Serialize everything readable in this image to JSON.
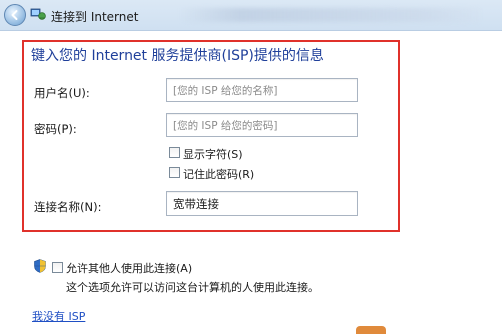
{
  "window": {
    "title": "连接到 Internet"
  },
  "form": {
    "heading": "键入您的 Internet 服务提供商(ISP)提供的信息",
    "username": {
      "label": "用户名(U):",
      "placeholder": "[您的 ISP 给您的名称]"
    },
    "password": {
      "label": "密码(P):",
      "placeholder": "[您的 ISP 给您的密码]"
    },
    "show_chars": {
      "label": "显示字符(S)",
      "checked": false
    },
    "remember_password": {
      "label": "记住此密码(R)",
      "checked": false
    },
    "connection_name": {
      "label": "连接名称(N):",
      "value": "宽带连接"
    }
  },
  "sharing": {
    "allow_label": "允许其他人使用此连接(A)",
    "allow_checked": false,
    "description": "这个选项允许可以访问这台计算机的人使用此连接。"
  },
  "links": {
    "no_isp": "我没有 ISP"
  },
  "colors": {
    "highlight_border": "#e0312b",
    "heading": "#1f3f9a",
    "link": "#1f4fc4"
  }
}
